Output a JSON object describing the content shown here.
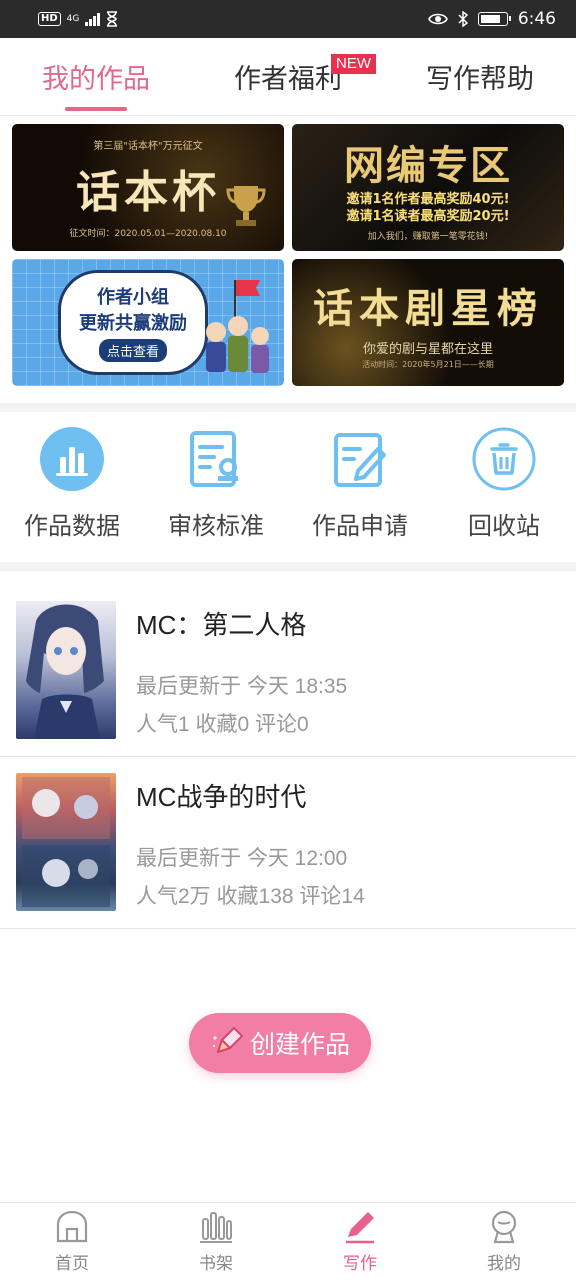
{
  "status_bar": {
    "left_badge": "HD",
    "network": "4G",
    "time": "6:46"
  },
  "tabs": [
    {
      "label": "我的作品",
      "active": true
    },
    {
      "label": "作者福利",
      "badge": "NEW"
    },
    {
      "label": "写作帮助"
    }
  ],
  "banners": {
    "b1": {
      "small": "第三届\"话本杯\"万元征文",
      "big": "话本杯",
      "foot": "征文时间：2020.05.01—2020.08.10"
    },
    "b2": {
      "big": "网编专区",
      "line1": "邀请1名作者最高奖励40元!",
      "line2": "邀请1名读者最高奖励20元!",
      "foot": "加入我们，赚取第一笔零花钱!"
    },
    "b3": {
      "line1": "作者小组",
      "line2": "更新共赢激励",
      "button": "点击查看"
    },
    "b4": {
      "big": "话本剧星榜",
      "line": "你爱的剧与星都在这里",
      "foot": "活动时间：2020年5月21日——长期"
    }
  },
  "quick_actions": [
    {
      "label": "作品数据",
      "icon": "bar-chart-icon"
    },
    {
      "label": "审核标准",
      "icon": "review-standard-icon"
    },
    {
      "label": "作品申请",
      "icon": "edit-document-icon"
    },
    {
      "label": "回收站",
      "icon": "trash-icon"
    }
  ],
  "works": [
    {
      "title": "MC：第二人格",
      "updated": "最后更新于 今天 18:35",
      "stats": "人气1 收藏0 评论0"
    },
    {
      "title": "MC战争的时代",
      "updated": "最后更新于 今天 12:00",
      "stats": "人气2万 收藏138 评论14"
    }
  ],
  "create_button": {
    "label": "创建作品"
  },
  "bottom_nav": [
    {
      "label": "首页",
      "icon": "home-icon"
    },
    {
      "label": "书架",
      "icon": "bookshelf-icon"
    },
    {
      "label": "写作",
      "icon": "pen-icon",
      "active": true
    },
    {
      "label": "我的",
      "icon": "profile-icon"
    }
  ],
  "colors": {
    "accent": "#e95f8e",
    "new_badge": "#e8314d",
    "icon_blue": "#5aaee8"
  }
}
